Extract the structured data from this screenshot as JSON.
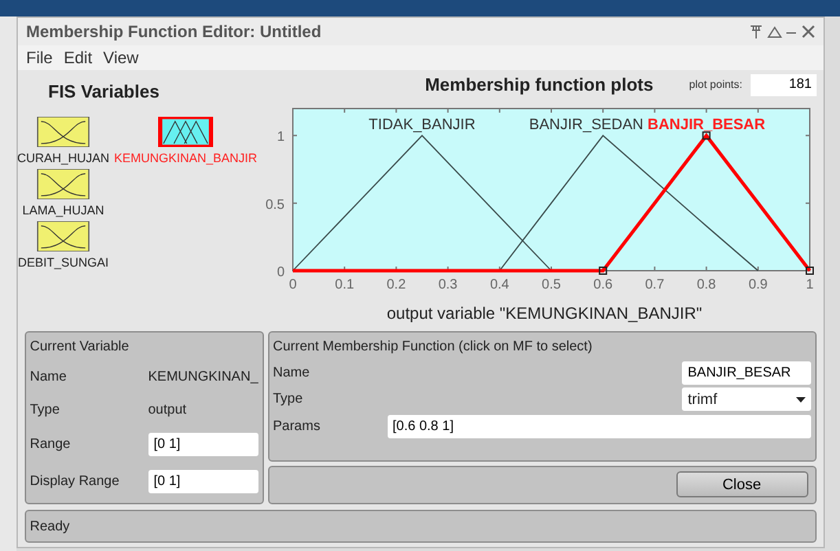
{
  "window": {
    "title": "Membership Function Editor: Untitled"
  },
  "menu": [
    "File",
    "Edit",
    "View"
  ],
  "fis_variables": {
    "title": "FIS Variables",
    "items": [
      {
        "name": "CURAH_HUJAN",
        "kind": "input",
        "selected": false
      },
      {
        "name": "KEMUNGKINAN_BANJIR",
        "kind": "output",
        "selected": true
      },
      {
        "name": "LAMA_HUJAN",
        "kind": "input",
        "selected": false
      },
      {
        "name": "DEBIT_SUNGAI",
        "kind": "input",
        "selected": false
      }
    ]
  },
  "plot": {
    "title": "Membership function plots",
    "plot_points_label": "plot points:",
    "plot_points": "181",
    "chart_data": {
      "type": "line",
      "xlabel": "output variable \"KEMUNGKINAN_BANJIR\"",
      "x": [
        0,
        0.25,
        0.4,
        0.5,
        0.6,
        0.8,
        0.9,
        1
      ],
      "series": [
        {
          "name": "TIDAK_BANJIR",
          "color": "#3a4a4a",
          "values": [
            0,
            1,
            0.4,
            0,
            null,
            null,
            null,
            null
          ]
        },
        {
          "name": "BANJIR_SEDAN",
          "color": "#3a4a4a",
          "values": [
            null,
            null,
            0,
            0.5,
            1,
            0.33,
            0,
            null
          ]
        },
        {
          "name": "BANJIR_BESAR",
          "color": "#ff0000",
          "values": [
            0,
            0,
            0,
            0,
            0,
            1,
            0.5,
            0
          ]
        }
      ],
      "xlim": [
        0,
        1
      ],
      "ylim": [
        0,
        1.2
      ],
      "xticks": [
        0,
        0.1,
        0.2,
        0.3,
        0.4,
        0.5,
        0.6,
        0.7,
        0.8,
        0.9,
        1
      ],
      "yticks": [
        0,
        0.5,
        1
      ]
    },
    "curves": [
      {
        "selected": false
      },
      {
        "selected": false
      },
      {
        "selected": true
      }
    ]
  },
  "current_variable": {
    "title": "Current Variable",
    "fields": [
      {
        "label": "Name",
        "value": "KEMUNGKINAN_",
        "kind": "text"
      },
      {
        "label": "Type",
        "value": "output",
        "kind": "text"
      },
      {
        "label": "Range",
        "value": "[0 1]",
        "kind": "input"
      },
      {
        "label": "Display Range",
        "value": "[0 1]",
        "kind": "input"
      }
    ]
  },
  "current_mf": {
    "title": "Current Membership Function (click on MF to select)",
    "name_label": "Name",
    "name": "BANJIR_BESAR",
    "type_label": "Type",
    "type": "trimf",
    "params_label": "Params",
    "params": "[0.6 0.8 1]"
  },
  "close_button": "Close",
  "status": "Ready"
}
